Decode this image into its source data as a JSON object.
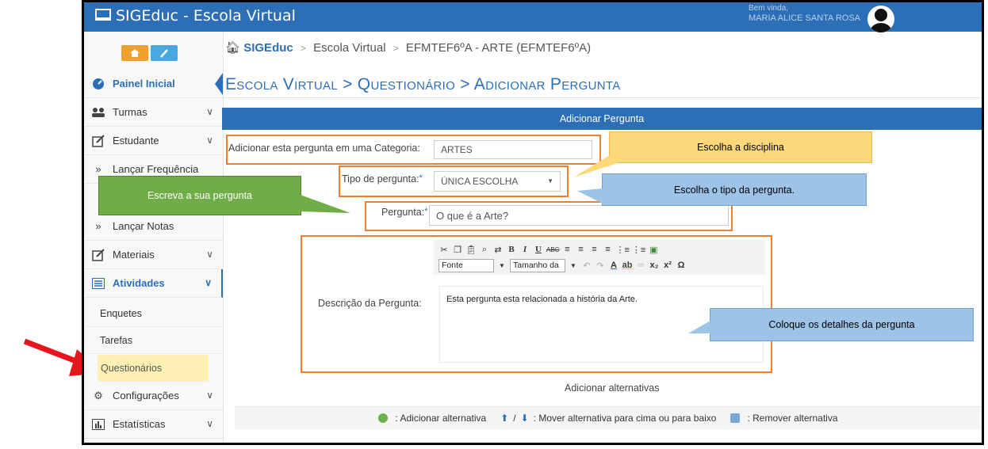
{
  "app": {
    "title": "SIGEduc - Escola Virtual"
  },
  "user": {
    "welcome": "Bem vinda,",
    "name": "MARIA ALICE SANTA ROSA"
  },
  "sidebar": {
    "items": [
      {
        "label": "Painel Inicial",
        "icon": "dashboard-icon"
      },
      {
        "label": "Turmas",
        "icon": "users-icon"
      },
      {
        "label": "Estudante",
        "icon": "edit-icon"
      },
      {
        "label": "Lançar Frequência",
        "icon": "double-chevron-icon"
      },
      {
        "label": "Lançar Notas",
        "icon": "double-chevron-icon"
      },
      {
        "label": "Materiais",
        "icon": "edit-icon"
      },
      {
        "label": "Atividades",
        "icon": "list-icon"
      },
      {
        "label": "Configurações",
        "icon": "gears-icon"
      },
      {
        "label": "Estatísticas",
        "icon": "bar-chart-icon"
      }
    ],
    "subitems": [
      "Enquetes",
      "Tarefas",
      "Questionários"
    ],
    "home_btn_color": "#f0a030",
    "edit_btn_color": "#4aa8e0"
  },
  "breadcrumb": {
    "home": "SIGEduc",
    "level2": "Escola Virtual",
    "level3": "EFMTEF6ºA - ARTE (EFMTEF6ºA)"
  },
  "page": {
    "title": "Escola Virtual > Questionário > Adicionar Pergunta"
  },
  "form": {
    "header": "Adicionar Pergunta",
    "category_label": "Adicionar esta pergunta em uma Categoria:",
    "category_value": "ARTES",
    "type_label": "Tipo de pergunta:",
    "type_value": "ÚNICA ESCOLHA",
    "question_label": "Pergunta:",
    "question_value": "O que é a Arte?",
    "description_label": "Descrição da Pergunta:",
    "description_value": "Esta pergunta esta relacionada a história da Arte.",
    "alternatives_label": "Adicionar alternativas"
  },
  "editor": {
    "font_select": "Fonte",
    "size_select": "Tamanho da"
  },
  "legend": {
    "add": ": Adicionar alternativa",
    "move": ": Mover alternativa para cima ou para baixo",
    "remove": ": Remover alternativa"
  },
  "callouts": {
    "discipline": "Escolha a disciplina",
    "type": "Escolha o tipo da pergunta.",
    "write": "Escreva a sua pergunta",
    "details": "Coloque os detalhes da pergunta"
  },
  "colors": {
    "primary": "#2d6fb7",
    "annotation_orange": "#ed7d31",
    "callout_yellow": "#fdd87a",
    "callout_blue": "#9dc3e6",
    "callout_green": "#70ad47",
    "arrow_red": "#e8141b"
  }
}
